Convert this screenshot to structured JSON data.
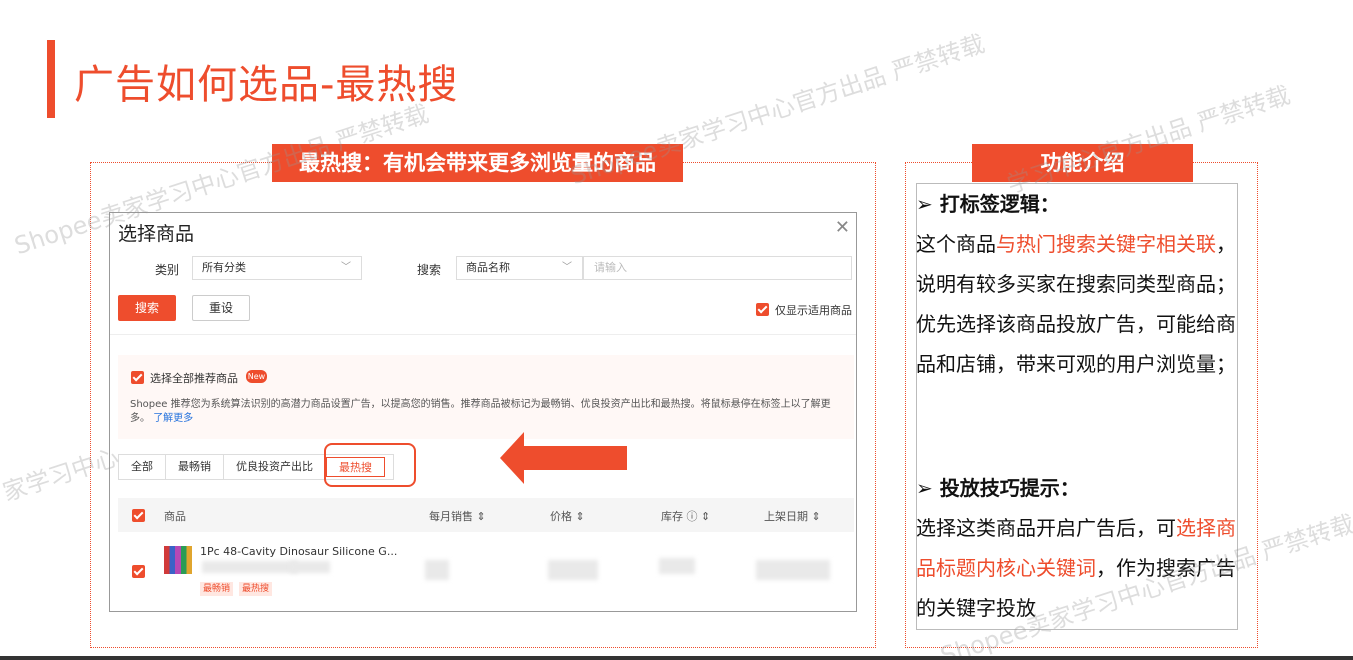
{
  "page": {
    "title": "广告如何选品-最热搜"
  },
  "left_panel": {
    "tag": "最热搜：有机会带来更多浏览量的商品"
  },
  "modal": {
    "title": "选择商品",
    "close_icon": "close-icon",
    "category_label": "类别",
    "category_value": "所有分类",
    "search_label": "搜索",
    "search_type_value": "商品名称",
    "search_placeholder": "请输入",
    "search_button": "搜索",
    "reset_button": "重设",
    "only_show_label": "仅显示适用商品",
    "select_all_label": "选择全部推荐商品",
    "new_badge": "New",
    "description": "Shopee 推荐您为系统算法识别的高潜力商品设置广告，以提高您的销售。推荐商品被标记为最畅销、优良投资产出比和最热搜。将鼠标悬停在标签上以了解更多。",
    "learn_more": "了解更多",
    "tabs": [
      {
        "label": "全部"
      },
      {
        "label": "最畅销"
      },
      {
        "label": "优良投资产出比"
      },
      {
        "label": "最热搜"
      }
    ],
    "table": {
      "columns": [
        "商品",
        "每月销售 ⇕",
        "价格 ⇕",
        "库存 ⓘ ⇕",
        "上架日期 ⇕"
      ],
      "rows": [
        {
          "name": "1Pc 48-Cavity Dinosaur Silicone G...",
          "badges": [
            "最畅销",
            "最热搜"
          ]
        }
      ]
    }
  },
  "right_panel": {
    "tag": "功能介绍",
    "section1_head": "➢  打标签逻辑：",
    "section1_a": "这个商品",
    "section1_hl": "与热门搜索关键字相关联",
    "section1_b": "，说明有较多买家在搜索同类型商品；优先选择该商品投放广告，可能给商品和店铺，带来可观的用户浏览量；",
    "section2_head": "➢  投放技巧提示：",
    "section2_a": "选择这类商品开启广告后，可",
    "section2_hl": "选择商品标题内核心关键词",
    "section2_b": "，作为搜索广告的关键字投放"
  },
  "watermarks": [
    "Shopee卖家学习中心官方出品 严禁转载",
    "Shopee卖家学习中心官方出品 严禁转载",
    "学习中心官方出品 严禁转载",
    "家学习中心",
    "Shopee卖家学习中心官方出品 严禁转载"
  ],
  "colors": {
    "accent": "#ee4d2d",
    "link": "#2673dd"
  }
}
